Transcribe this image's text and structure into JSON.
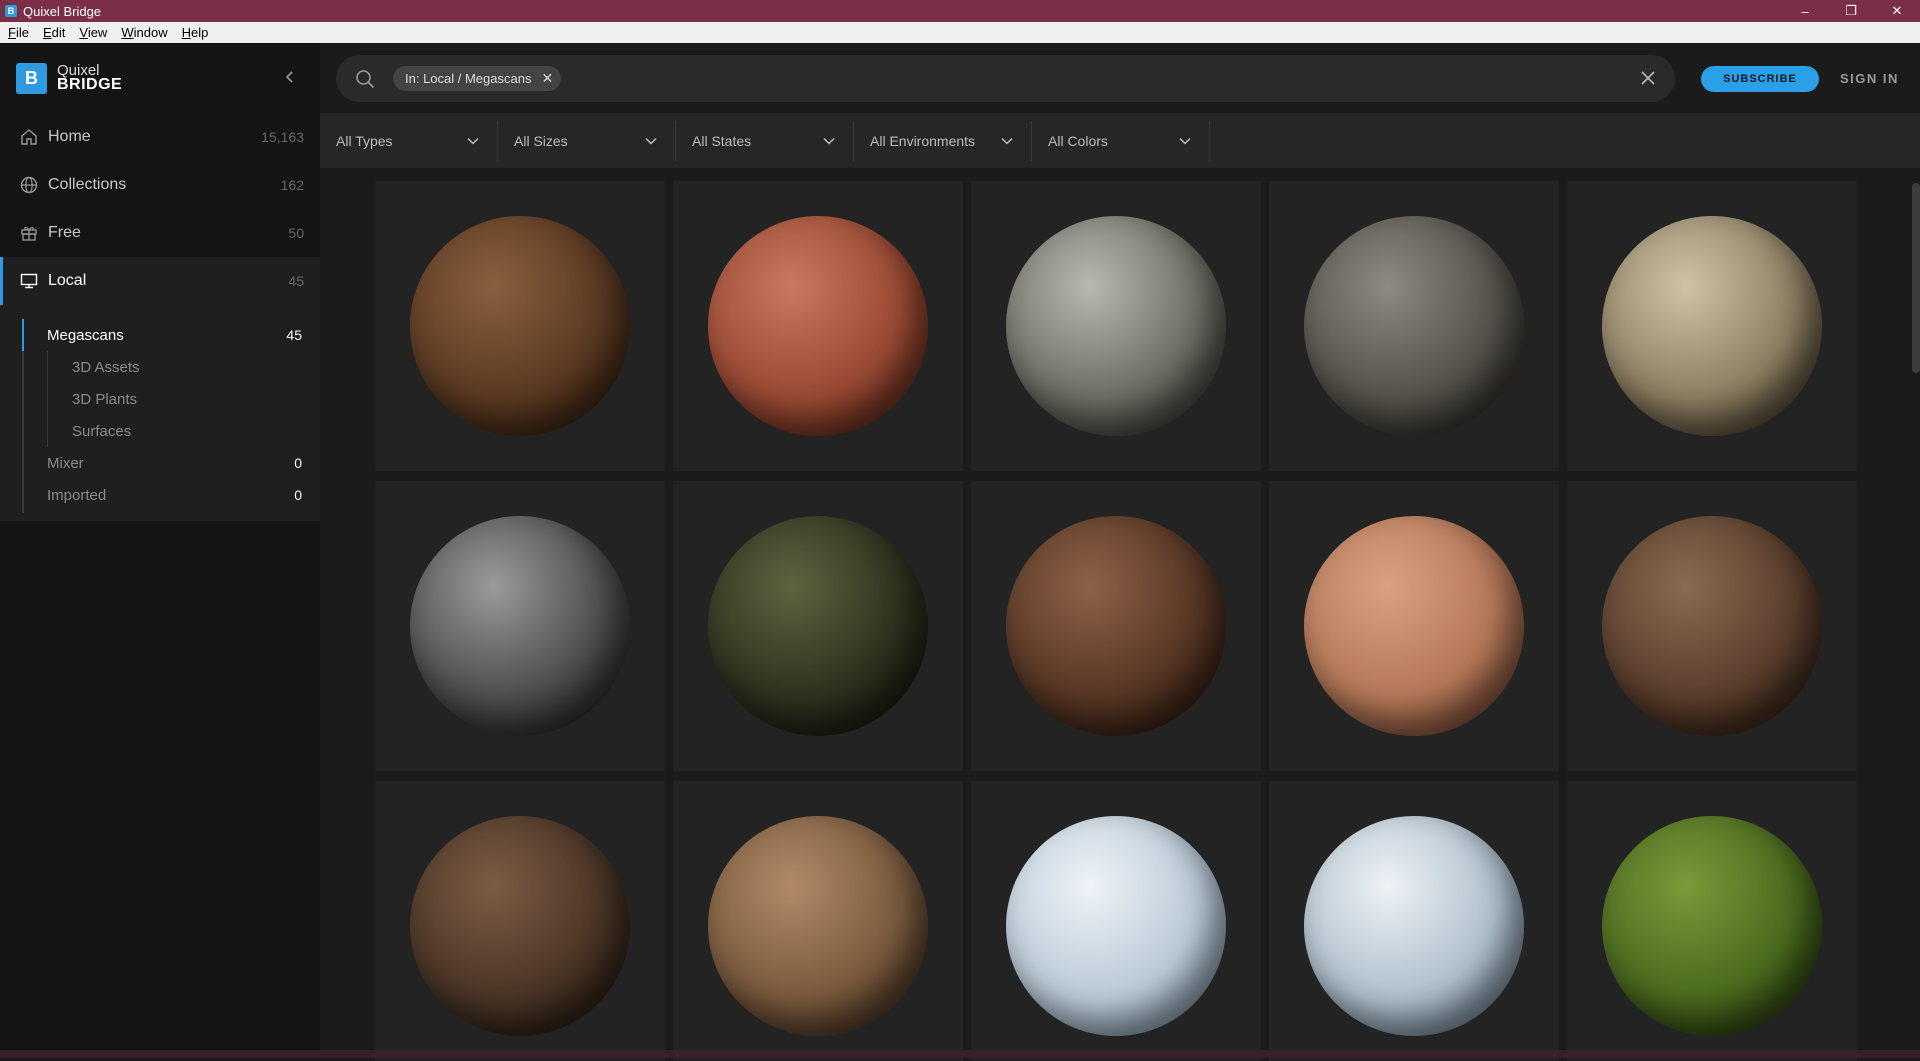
{
  "window": {
    "title": "Quixel Bridge",
    "minimize": "–",
    "maximize": "❐",
    "close": "✕"
  },
  "menu": [
    "File",
    "Edit",
    "View",
    "Window",
    "Help"
  ],
  "brand": {
    "line1": "Quixel",
    "line2": "BRIDGE",
    "logo_letter": "B"
  },
  "nav": [
    {
      "label": "Home",
      "count": "15,163",
      "icon": "home-icon"
    },
    {
      "label": "Collections",
      "count": "162",
      "icon": "globe-icon"
    },
    {
      "label": "Free",
      "count": "50",
      "icon": "gift-icon"
    },
    {
      "label": "Local",
      "count": "45",
      "icon": "monitor-icon"
    }
  ],
  "subnav": {
    "megascans": {
      "label": "Megascans",
      "count": "45"
    },
    "children": [
      "3D Assets",
      "3D Plants",
      "Surfaces"
    ],
    "mixer": {
      "label": "Mixer",
      "count": "0"
    },
    "imported": {
      "label": "Imported",
      "count": "0"
    }
  },
  "search": {
    "chip": "In: Local / Megascans",
    "value": ""
  },
  "header": {
    "subscribe": "SUBSCRIBE",
    "signin": "SIGN IN"
  },
  "filters": [
    "All Types",
    "All Sizes",
    "All States",
    "All Environments",
    "All Colors"
  ],
  "colors": {
    "accent": "#2f9ae0",
    "titlebar": "#7a2f47",
    "sidebar": "#141414",
    "main": "#1b1b1b"
  },
  "assets": [
    {
      "name": "brown-dirt-sphere",
      "c1": "#8a5f3e",
      "c2": "#5a3a22",
      "c3": "#2a170b"
    },
    {
      "name": "red-clay-sphere",
      "c1": "#c9785e",
      "c2": "#9a4a34",
      "c3": "#4a1d12"
    },
    {
      "name": "gray-cliff-rock-sphere",
      "c1": "#b8b8ae",
      "c2": "#6e6e66",
      "c3": "#24241f"
    },
    {
      "name": "dark-rock-sphere",
      "c1": "#8c8a82",
      "c2": "#55524b",
      "c3": "#1e1c18"
    },
    {
      "name": "beige-rock-sphere",
      "c1": "#cfc3a6",
      "c2": "#8c7e62",
      "c3": "#2e271a"
    },
    {
      "name": "gravel-sphere",
      "c1": "#9a9a9a",
      "c2": "#4e4e4e",
      "c3": "#141414"
    },
    {
      "name": "mossy-stones-sphere",
      "c1": "#5e6440",
      "c2": "#2e321e",
      "c3": "#0d0f08"
    },
    {
      "name": "rocky-soil-sphere",
      "c1": "#8e6248",
      "c2": "#573624",
      "c3": "#1f120a"
    },
    {
      "name": "tan-ground-sphere",
      "c1": "#d9a080",
      "c2": "#b37758",
      "c3": "#5c3524"
    },
    {
      "name": "forest-soil-sphere",
      "c1": "#8a6a52",
      "c2": "#5a3e2c",
      "c3": "#20140c"
    },
    {
      "name": "wood-bark-sphere",
      "c1": "#7c5c44",
      "c2": "#4a3526",
      "c3": "#1a110b"
    },
    {
      "name": "dry-soil-sphere",
      "c1": "#b08a66",
      "c2": "#7a5a3e",
      "c3": "#2e2014"
    },
    {
      "name": "snow-sphere",
      "c1": "#eef3f7",
      "c2": "#b9c9d6",
      "c3": "#6a7f90"
    },
    {
      "name": "ice-cliff-sphere",
      "c1": "#eef2f5",
      "c2": "#aebfcc",
      "c3": "#56687a"
    },
    {
      "name": "moss-grass-sphere",
      "c1": "#7a9a3a",
      "c2": "#4a6a1e",
      "c3": "#1a2a08"
    }
  ]
}
